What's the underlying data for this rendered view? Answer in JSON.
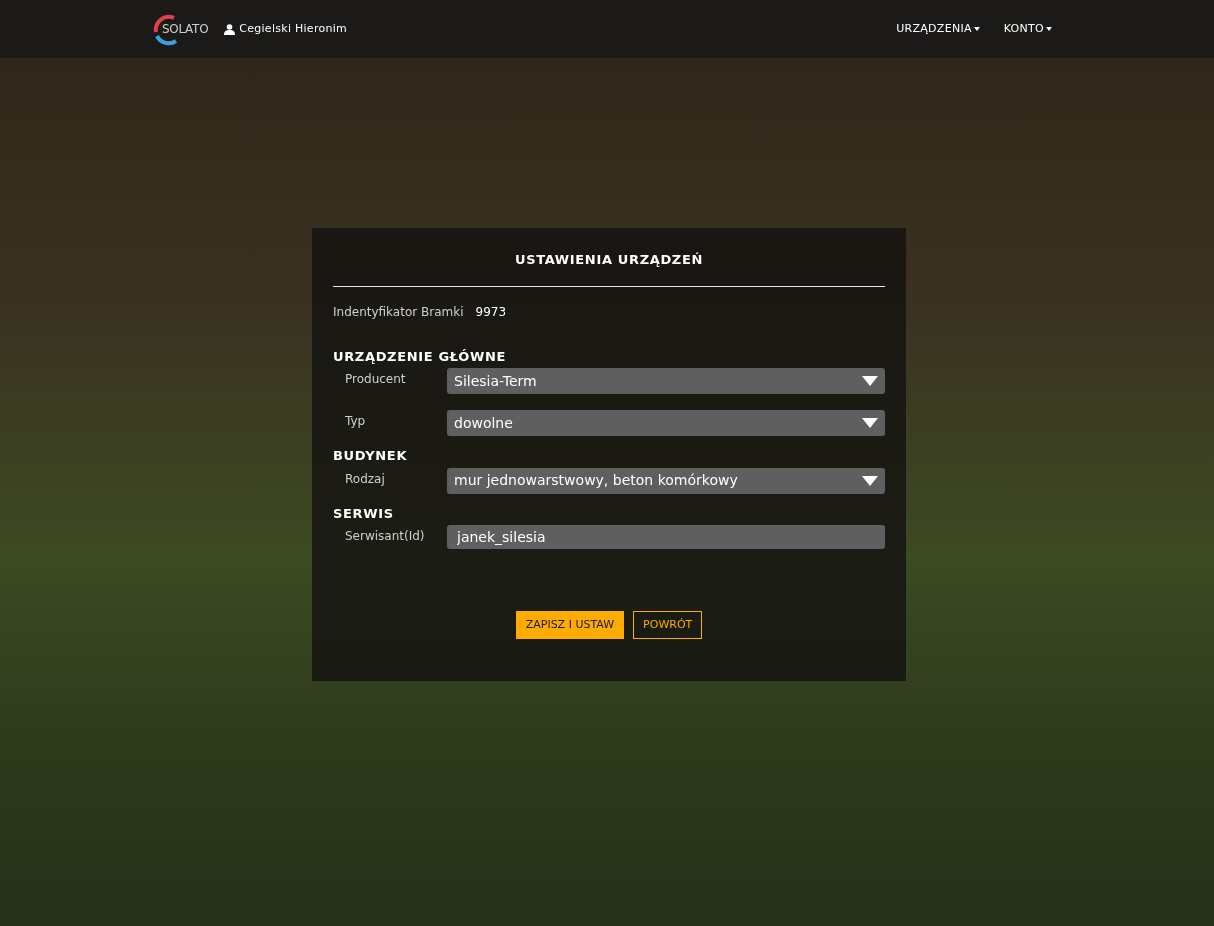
{
  "navbar": {
    "logo": "SOLATO",
    "user": "Cegielski Hieronim",
    "menus": [
      {
        "label": "URZĄDZENIA"
      },
      {
        "label": "KONTO"
      }
    ]
  },
  "panel": {
    "title": "USTAWIENIA URZĄDZEŃ",
    "gateway": {
      "label": "Indentyfikator Bramki",
      "value": "9973"
    },
    "sections": [
      {
        "title": "URZĄDZENIE GŁÓWNE",
        "fields": [
          {
            "kind": "select",
            "label": "Producent",
            "value": "Silesia-Term"
          },
          {
            "kind": "select",
            "label": "Typ",
            "value": "dowolne"
          }
        ]
      },
      {
        "title": "BUDYNEK",
        "fields": [
          {
            "kind": "select",
            "label": "Rodzaj",
            "value": "mur jednowarstwowy, beton komórkowy"
          }
        ]
      },
      {
        "title": "SERWIS",
        "fields": [
          {
            "kind": "text",
            "label": "Serwisant(Id)",
            "value": "janek_silesia"
          }
        ]
      }
    ],
    "buttons": [
      {
        "kind": "primary",
        "label": "ZAPISZ I USTAW"
      },
      {
        "kind": "outline",
        "label": "POWRÓT"
      }
    ]
  }
}
